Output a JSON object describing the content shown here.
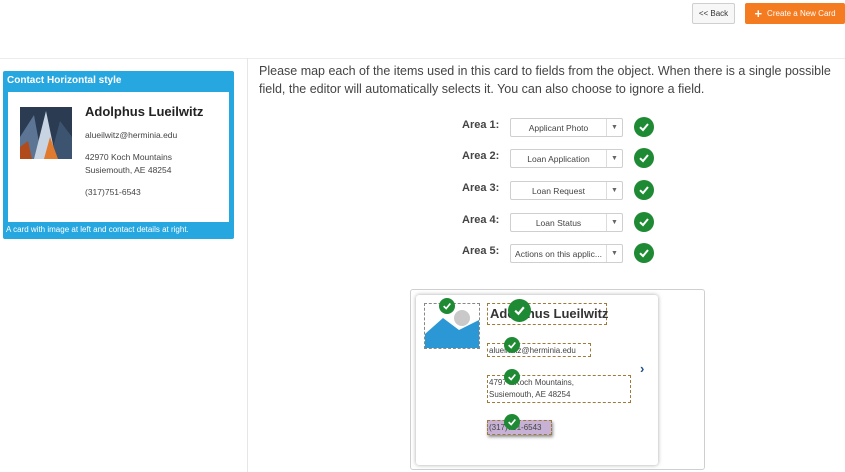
{
  "toolbar": {
    "back_label": "<< Back",
    "create_label": "Create a New Card",
    "accent_color": "#f47b20"
  },
  "card_preview": {
    "title": "Contact Horizontal style",
    "description": "A card with image at left and contact details at right.",
    "name": "Adolphus Lueilwitz",
    "email": "alueilwitz@herminia.edu",
    "address_line1": "42970 Koch Mountains",
    "address_line2": "Susiemouth, AE  48254",
    "phone": "(317)751-6543",
    "header_color": "#27a7e0"
  },
  "instructions": "Please map each of the items used in this card to fields from the object. When there is a single possible field, the editor will automatically selects it. You can also choose to ignore a field.",
  "areas": [
    {
      "label": "Area 1:",
      "value": "Applicant Photo"
    },
    {
      "label": "Area 2:",
      "value": "Loan Application"
    },
    {
      "label": "Area 3:",
      "value": "Loan Request"
    },
    {
      "label": "Area 4:",
      "value": "Loan Status"
    },
    {
      "label": "Area 5:",
      "value": "Actions on this applic..."
    }
  ],
  "mapping_preview": {
    "name": "Adolphus Lueilwitz",
    "email": "alueilwitz@herminia.edu",
    "address_line1": "4797 KKoch Mountains,",
    "address_line2": "Susiemouth, AE 48254",
    "phone": "(317)751-6543",
    "check_color": "#1f8a34"
  }
}
